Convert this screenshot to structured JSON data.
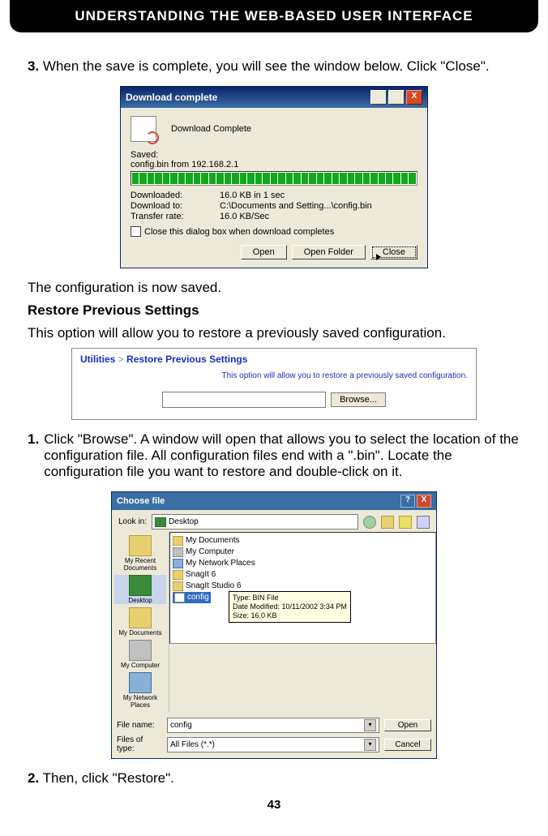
{
  "header": {
    "title": "UNDERSTANDING THE WEB-BASED USER INTERFACE"
  },
  "step3": {
    "num": "3.",
    "text": "When the save is complete, you will see the window below. Click \"Close\"."
  },
  "download_dialog": {
    "title": "Download complete",
    "heading": "Download Complete",
    "saved_label": "Saved:",
    "saved_file": "config.bin from 192.168.2.1",
    "rows": {
      "downloaded_label": "Downloaded:",
      "downloaded_value": "16.0 KB in 1 sec",
      "downloadto_label": "Download to:",
      "downloadto_value": "C:\\Documents and Setting...\\config.bin",
      "rate_label": "Transfer rate:",
      "rate_value": "16.0 KB/Sec"
    },
    "checkbox_label": "Close this dialog box when download completes",
    "buttons": {
      "open": "Open",
      "open_folder": "Open Folder",
      "close": "Close"
    },
    "win_controls": {
      "min": "_",
      "max": "□",
      "close": "X"
    }
  },
  "para_saved": "The configuration is now saved.",
  "subhead_restore": "Restore Previous Settings",
  "para_restore_desc": "This option will allow you to restore a previously saved configuration.",
  "restore_panel": {
    "crumb_a": "Utilities",
    "crumb_sep": ">",
    "crumb_b": "Restore Previous Settings",
    "desc": "This option will allow you to restore a previously saved configuration.",
    "browse": "Browse..."
  },
  "step1": {
    "num": "1.",
    "text": "Click \"Browse\". A window will open that allows you to select the location of the configuration file. All configuration files end with a \".bin\". Locate the configuration file you want to restore and double-click on it."
  },
  "choose_file": {
    "title": "Choose file",
    "help": "?",
    "close": "X",
    "lookin_label": "Look in:",
    "lookin_value": "Desktop",
    "places": {
      "recent": "My Recent Documents",
      "desktop": "Desktop",
      "mydocs": "My Documents",
      "mycomp": "My Computer",
      "mynet": "My Network Places"
    },
    "files": {
      "f1": "My Documents",
      "f2": "My Computer",
      "f3": "My Network Places",
      "f4": "SnagIt 6",
      "f5": "SnagIt Studio 6",
      "f6": "config"
    },
    "tooltip": {
      "l1": "Type: BIN File",
      "l2": "Date Modified: 10/11/2002 3:34 PM",
      "l3": "Size: 16.0 KB"
    },
    "filename_label": "File name:",
    "filename_value": "config",
    "filetype_label": "Files of type:",
    "filetype_value": "All Files (*.*)",
    "open": "Open",
    "cancel": "Cancel"
  },
  "step2": {
    "num": "2.",
    "text": "Then, click \"Restore\"."
  },
  "page_number": "43"
}
